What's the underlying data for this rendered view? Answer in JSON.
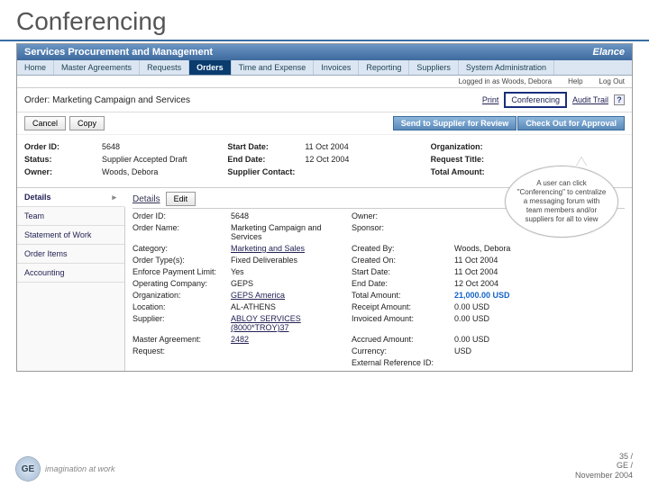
{
  "page": {
    "title": "Conferencing"
  },
  "header": {
    "title": "Services Procurement and Management",
    "brand": "Elance"
  },
  "nav": {
    "items": [
      {
        "label": "Home"
      },
      {
        "label": "Master Agreements"
      },
      {
        "label": "Requests"
      },
      {
        "label": "Orders",
        "active": true
      },
      {
        "label": "Time and Expense"
      },
      {
        "label": "Invoices"
      },
      {
        "label": "Reporting"
      },
      {
        "label": "Suppliers"
      },
      {
        "label": "System Administration"
      }
    ]
  },
  "userrow": {
    "logged_in": "Logged in as Woods, Debora",
    "help": "Help",
    "logout": "Log Out"
  },
  "orderbar": {
    "title": "Order: Marketing Campaign and Services",
    "print": "Print",
    "conferencing": "Conferencing",
    "audit": "Audit Trail",
    "help_icon": "?"
  },
  "actions": {
    "cancel": "Cancel",
    "copy": "Copy",
    "review": "Send to Supplier for Review",
    "checkout": "Check Out for Approval"
  },
  "summary": {
    "col1": {
      "order_id_l": "Order ID:",
      "order_id_v": "5648",
      "status_l": "Status:",
      "status_v": "Supplier Accepted Draft",
      "owner_l": "Owner:",
      "owner_v": "Woods, Debora"
    },
    "col2": {
      "start_l": "Start Date:",
      "start_v": "11 Oct 2004",
      "end_l": "End Date:",
      "end_v": "12 Oct 2004",
      "suppc_l": "Supplier Contact:",
      "suppc_v": ""
    },
    "col3": {
      "org_l": "Organization:",
      "org_v": "",
      "req_l": "Request Title:",
      "req_v": "",
      "total_l": "Total Amount:",
      "total_v": ""
    }
  },
  "sidebar": {
    "items": [
      {
        "label": "Details",
        "active": true
      },
      {
        "label": "Team"
      },
      {
        "label": "Statement of Work"
      },
      {
        "label": "Order Items"
      },
      {
        "label": "Accounting"
      }
    ]
  },
  "details": {
    "section": "Details",
    "edit": "Edit",
    "rows": [
      [
        "Order ID:",
        "5648",
        "Owner:",
        ""
      ],
      [
        "Order Name:",
        "Marketing Campaign and Services",
        "Sponsor:",
        ""
      ],
      [
        "Category:",
        "Marketing and Sales",
        "Created By:",
        "Woods, Debora"
      ],
      [
        "Order Type(s):",
        "Fixed Deliverables",
        "Created On:",
        "11 Oct 2004"
      ],
      [
        "Enforce Payment Limit:",
        "Yes",
        "Start Date:",
        "11 Oct 2004"
      ],
      [
        "Operating Company:",
        "GEPS",
        "End Date:",
        "12 Oct 2004"
      ],
      [
        "Organization:",
        "GEPS America",
        "Total Amount:",
        "21,000.00 USD"
      ],
      [
        "Location:",
        "AL-ATHENS",
        "Receipt Amount:",
        "0.00 USD"
      ],
      [
        "Supplier:",
        "ABLOY SERVICES (8000*TROY)37",
        "Invoiced Amount:",
        "0.00 USD"
      ],
      [
        "Master Agreement:",
        "2482",
        "Accrued Amount:",
        "0.00 USD"
      ],
      [
        "Request:",
        "",
        "Currency:",
        "USD"
      ],
      [
        "",
        "",
        "External Reference ID:",
        ""
      ]
    ]
  },
  "callout": {
    "text": "A user can click \"Conferencing\" to centralize a messaging forum with team members and/or suppliers for all to view"
  },
  "footer": {
    "logo_text": "GE",
    "tagline": "imagination at work",
    "meta1": "35 /",
    "meta2": "GE /",
    "meta3": "November 2004"
  }
}
